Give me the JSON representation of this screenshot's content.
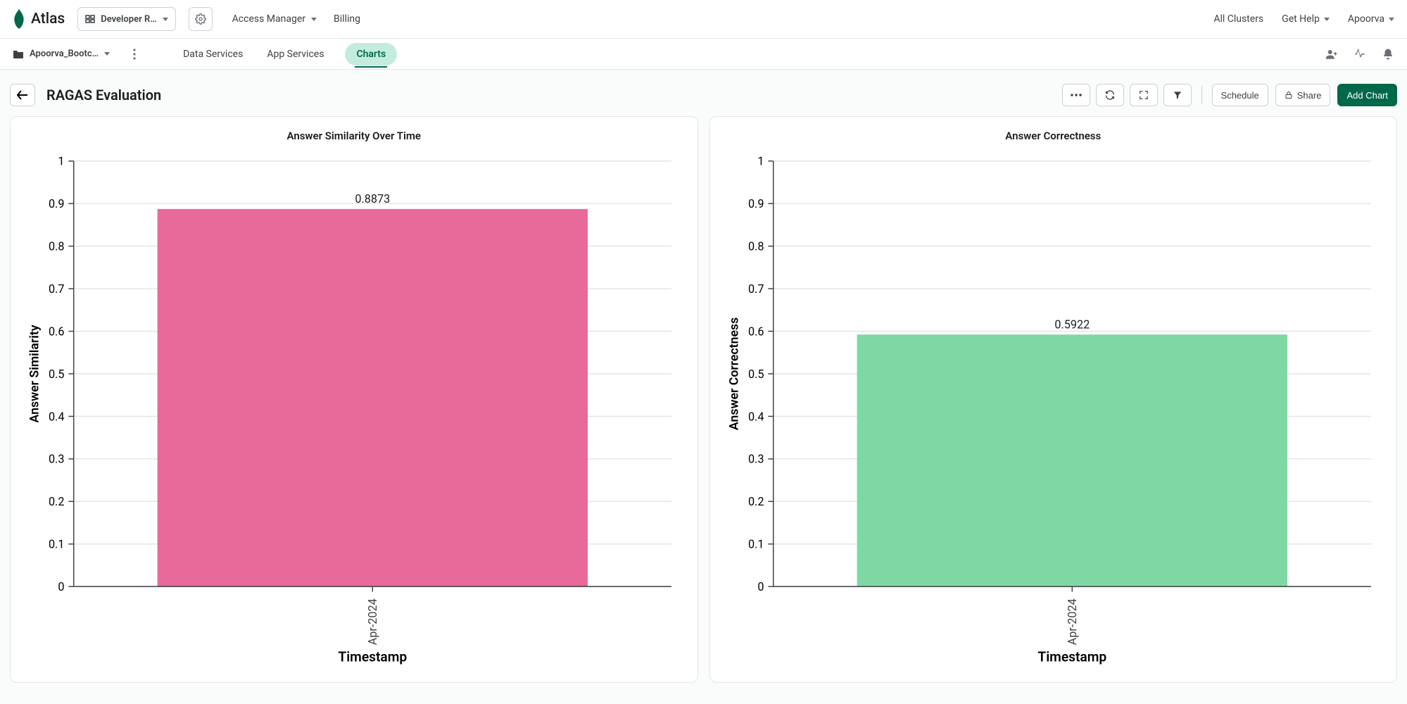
{
  "brand": "Atlas",
  "org_picker": {
    "label": "Developer R…"
  },
  "top_nav": {
    "access_manager": "Access Manager",
    "billing": "Billing"
  },
  "top_right": {
    "all_clusters": "All Clusters",
    "get_help": "Get Help",
    "user": "Apoorva"
  },
  "project_picker": {
    "label": "Apoorva_Bootc…"
  },
  "tabs": {
    "data_services": "Data Services",
    "app_services": "App Services",
    "charts": "Charts"
  },
  "page": {
    "title": "RAGAS Evaluation"
  },
  "actions": {
    "schedule": "Schedule",
    "share": "Share",
    "add_chart": "Add Chart"
  },
  "chart_data": [
    {
      "type": "bar",
      "title": "Answer Similarity Over Time",
      "xlabel": "Timestamp",
      "ylabel": "Answer Similarity",
      "categories": [
        "Apr-2024"
      ],
      "values": [
        0.8873
      ],
      "value_label": "0.8873",
      "ylim": [
        0,
        1
      ],
      "yticks": [
        0,
        0.1,
        0.2,
        0.3,
        0.4,
        0.5,
        0.6,
        0.7,
        0.8,
        0.9,
        1
      ],
      "color": "#e76a9b"
    },
    {
      "type": "bar",
      "title": "Answer Correctness",
      "xlabel": "Timestamp",
      "ylabel": "Answer Correctness",
      "categories": [
        "Apr-2024"
      ],
      "values": [
        0.5922
      ],
      "value_label": "0.5922",
      "ylim": [
        0,
        1
      ],
      "yticks": [
        0,
        0.1,
        0.2,
        0.3,
        0.4,
        0.5,
        0.6,
        0.7,
        0.8,
        0.9,
        1
      ],
      "color": "#7fd8a3"
    }
  ]
}
